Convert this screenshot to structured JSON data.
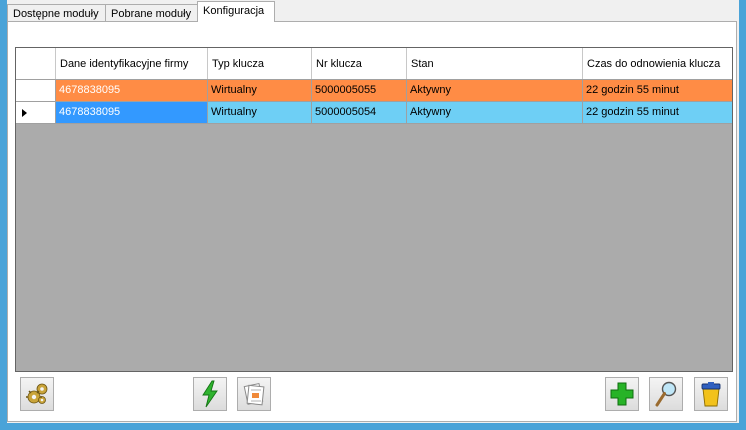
{
  "tabs": [
    {
      "label": "Dostępne moduły",
      "active": false
    },
    {
      "label": "Pobrane moduły",
      "active": false
    },
    {
      "label": "Konfiguracja",
      "active": true
    }
  ],
  "grid": {
    "columns": [
      "Dane identyfikacyjne firmy",
      "Typ klucza",
      "Nr klucza",
      "Stan",
      "Czas do odnowienia klucza"
    ],
    "rows": [
      {
        "firm": "4678838095",
        "type": "Wirtualny",
        "number": "5000005055",
        "state": "Aktywny",
        "time": "22 godzin 55 minut",
        "color": "#ff8c45",
        "current": false
      },
      {
        "firm": "4678838095",
        "type": "Wirtualny",
        "number": "5000005054",
        "state": "Aktywny",
        "time": "22 godzin 55 minut",
        "color": "#6ecff5",
        "current": true
      }
    ]
  },
  "toolbar": {
    "left_icon": "gears-icon",
    "middle_icons": [
      "lightning-icon",
      "documents-icon"
    ],
    "right_icons": [
      "add-plus-icon",
      "magnifier-icon",
      "trash-bin-icon"
    ]
  },
  "colors": {
    "window_border": "#4aa3d8",
    "row_orange": "#ff8c45",
    "row_blue": "#6ecff5",
    "selection": "#3399ff",
    "grid_background": "#ababab"
  }
}
